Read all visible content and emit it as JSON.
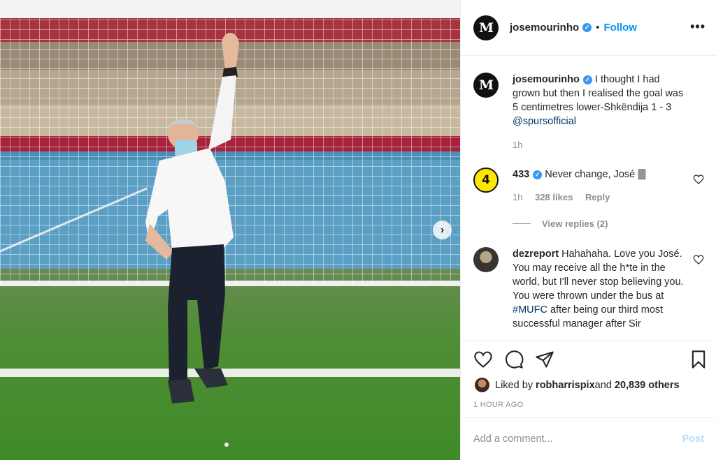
{
  "post": {
    "author": "josemourinho",
    "follow_label": "Follow",
    "more_label": "•••",
    "avatar_letter": "M",
    "caption_before": " I thought I had grown but then I realised the goal was 5 centimetres lower-Shkëndija 1 - 3 ",
    "caption_mention": "@spursofficial",
    "caption_time": "1h",
    "carousel_next": "›"
  },
  "comments": [
    {
      "user": "433",
      "avatar_text": "4",
      "text": " Never change, José 🀫",
      "time": "1h",
      "likes": "328 likes",
      "reply": "Reply",
      "view_replies": "View replies (2)"
    },
    {
      "user": "dezreport",
      "text": " Hahahaha. Love you José. You may receive all the h*te in the world, but I'll never stop believing you. You were thrown under the bus at ",
      "hashtag": "#MUFC",
      "text_after": " after being our third most successful manager after Sir"
    }
  ],
  "actions": {
    "liked_prefix": "Liked by ",
    "liked_user": "robharrispix",
    "liked_mid": " and ",
    "liked_count": "20,839 others",
    "time_ago": "1 HOUR AGO"
  },
  "add_comment": {
    "placeholder": "Add a comment...",
    "post_label": "Post"
  },
  "colors": {
    "link": "#00376b",
    "follow": "#0095f6",
    "verified": "#3897f0",
    "muted": "#8e8e8e"
  }
}
